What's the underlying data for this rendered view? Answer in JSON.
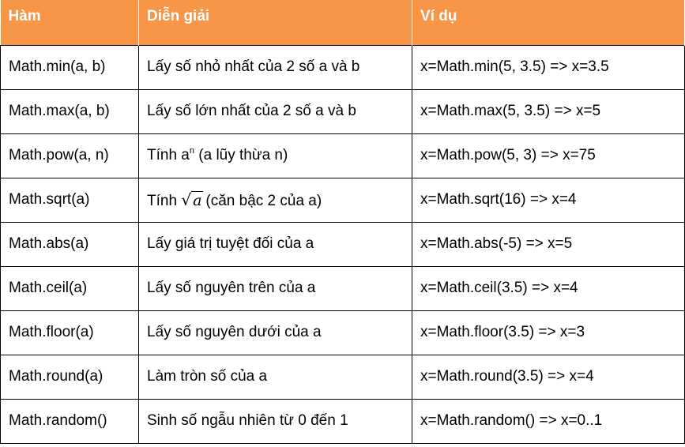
{
  "header": {
    "col1": "Hàm",
    "col2": "Diễn giải",
    "col3": "Ví dụ"
  },
  "rows": [
    {
      "func": "Math.min(a, b)",
      "desc": "Lấy số nhỏ nhất của 2 số a và b",
      "example": "x=Math.min(5, 3.5) => x=3.5"
    },
    {
      "func": "Math.max(a, b)",
      "desc": "Lấy số lớn nhất của 2 số a và b",
      "example": "x=Math.max(5, 3.5) => x=5"
    },
    {
      "func": "Math.pow(a, n)",
      "desc_prefix": "Tính a",
      "desc_sup": "n",
      "desc_suffix": " (a lũy thừa n)",
      "example": "x=Math.pow(5, 3) => x=75"
    },
    {
      "func": "Math.sqrt(a)",
      "desc_prefix": "Tính ",
      "desc_radicand": "a",
      "desc_suffix": "(căn bậc 2 của a)",
      "example": "x=Math.sqrt(16) => x=4"
    },
    {
      "func": "Math.abs(a)",
      "desc": "Lấy giá trị tuyệt đối của a",
      "example": "x=Math.abs(-5) => x=5"
    },
    {
      "func": "Math.ceil(a)",
      "desc": "Lấy số nguyên trên của a",
      "example": "x=Math.ceil(3.5) => x=4"
    },
    {
      "func": "Math.floor(a)",
      "desc": "Lấy số nguyên dưới của a",
      "example": "x=Math.floor(3.5) => x=3"
    },
    {
      "func": "Math.round(a)",
      "desc": "Làm tròn số của a",
      "example": "x=Math.round(3.5) => x=4"
    },
    {
      "func": "Math.random()",
      "desc": "Sinh số ngẫu nhiên từ 0 đến 1",
      "example": "x=Math.random() => x=0..1"
    }
  ]
}
